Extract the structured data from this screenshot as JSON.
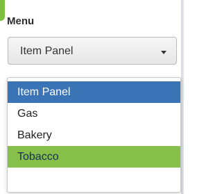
{
  "menu": {
    "label": "Menu",
    "selected_value": "Item Panel",
    "options": [
      {
        "label": "Item Panel",
        "state": "selected"
      },
      {
        "label": "Gas",
        "state": "normal"
      },
      {
        "label": "Bakery",
        "state": "normal"
      },
      {
        "label": "Tobacco",
        "state": "hovered"
      }
    ]
  },
  "icons": {
    "dropdown_caret": "chevron-down-icon"
  },
  "colors": {
    "selected_option_bg": "#3b73b7",
    "hovered_option_bg": "#86c04a",
    "accent_green": "#7dbf3e"
  }
}
